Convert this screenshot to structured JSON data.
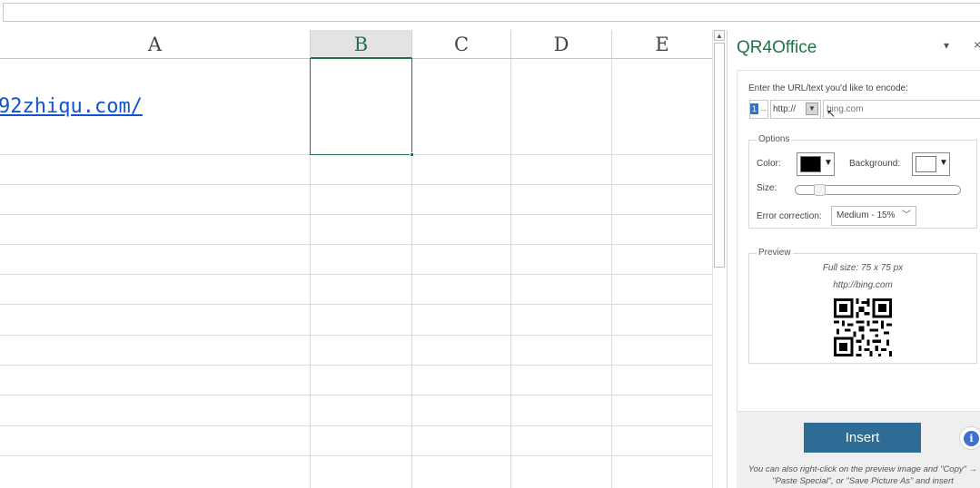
{
  "spreadsheet": {
    "columns": [
      {
        "label": "A"
      },
      {
        "label": "B",
        "selected": true
      },
      {
        "label": "C"
      },
      {
        "label": "D"
      },
      {
        "label": "E"
      }
    ],
    "cell_a_value": "92zhiqu.com/",
    "accent_color": "#217346"
  },
  "pane": {
    "title": "QR4Office",
    "menu_icon": "chevron-down-icon",
    "close_icon": "close-icon",
    "encode_label": "Enter the URL/text you'd like to encode:",
    "protocol_value": "http://",
    "url_placeholder": "bing.com",
    "options": {
      "legend": "Options",
      "color_label": "Color:",
      "color_value": "#000000",
      "background_label": "Background:",
      "background_value": "#ffffff",
      "size_label": "Size:",
      "size_fraction": 0.12,
      "error_label": "Error correction:",
      "error_value": "Medium - 15%"
    },
    "preview": {
      "legend": "Preview",
      "full_size": "Full size: 75 x 75 px",
      "url": "http://bing.com"
    },
    "insert_label": "Insert",
    "info_icon": "info-icon",
    "hint": "You can also right-click on the preview image and \"Copy\" → \"Paste Special\", or \"Save Picture As\" and insert"
  }
}
